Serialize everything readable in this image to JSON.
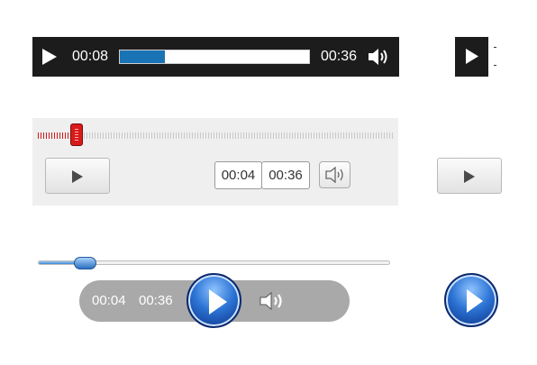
{
  "player_dark": {
    "current_time": "00:08",
    "duration": "00:36",
    "progress_fraction": 0.24,
    "colors": {
      "background": "#1c1c1c",
      "progress": "#1a73b5"
    }
  },
  "player_light": {
    "current_time": "00:04",
    "duration": "00:36",
    "progress_fraction": 0.11,
    "colors": {
      "background": "#efefef",
      "progress": "#c81e1e"
    }
  },
  "player_orb": {
    "current_time": "00:04",
    "duration": "00:36",
    "progress_fraction": 0.14,
    "colors": {
      "bar": "#a9a9a9",
      "accent": "#2c74d4"
    }
  },
  "icons": [
    "play-icon",
    "volume-icon"
  ]
}
